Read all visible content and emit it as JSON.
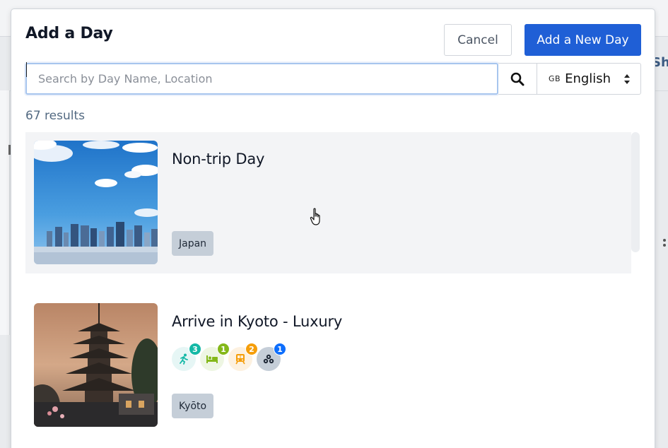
{
  "background": {
    "share_label": "Sha"
  },
  "modal": {
    "title": "Add a Day",
    "cancel_label": "Cancel",
    "add_label": "Add a New Day",
    "search": {
      "placeholder": "Search by Day Name, Location",
      "value": ""
    },
    "language": {
      "flag": "GB",
      "label": "English"
    },
    "results_count": "67 results"
  },
  "days": [
    {
      "title": "Non-trip Day",
      "location": "Japan",
      "thumbnail": "tokyo-skyline",
      "badges": []
    },
    {
      "title": "Arrive in Kyoto - Luxury",
      "location": "Kyōto",
      "thumbnail": "kyoto-pagoda",
      "badges": [
        {
          "icon": "activity-icon",
          "count": "3",
          "bg": "#e6f6f5",
          "color": "#14b8a6"
        },
        {
          "icon": "hotel-icon",
          "count": "1",
          "bg": "#eef6e3",
          "color": "#84b81a"
        },
        {
          "icon": "train-icon",
          "count": "2",
          "bg": "#fdf1e0",
          "color": "#f59e0b"
        },
        {
          "icon": "misc-icon",
          "count": "1",
          "bg": "#c5ced8",
          "color": "#0d6efd"
        }
      ]
    }
  ],
  "colors": {
    "primary": "#1f5fd6",
    "tag_bg": "#c5ced8",
    "results_text": "#536a82"
  }
}
